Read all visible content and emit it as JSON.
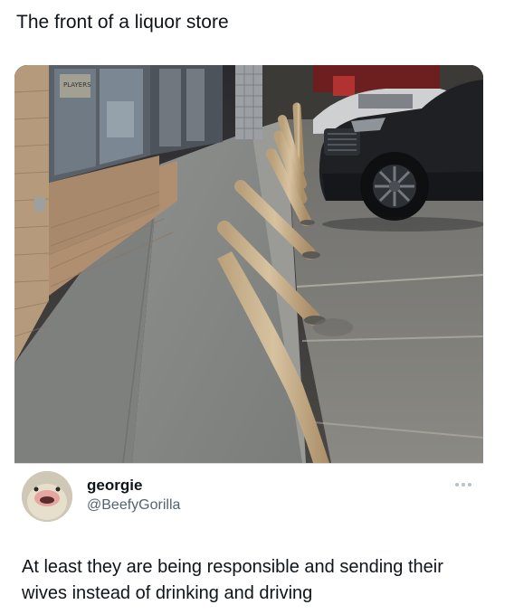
{
  "post": {
    "caption": "The front of a liquor store"
  },
  "tweet": {
    "display_name": "georgie",
    "handle": "@BeefyGorilla",
    "text": "At least they are being responsible and sending their wives instead of drinking and driving",
    "more_icon": "more-horizontal-icon"
  },
  "photo": {
    "sign_text": "PLAYERS"
  }
}
